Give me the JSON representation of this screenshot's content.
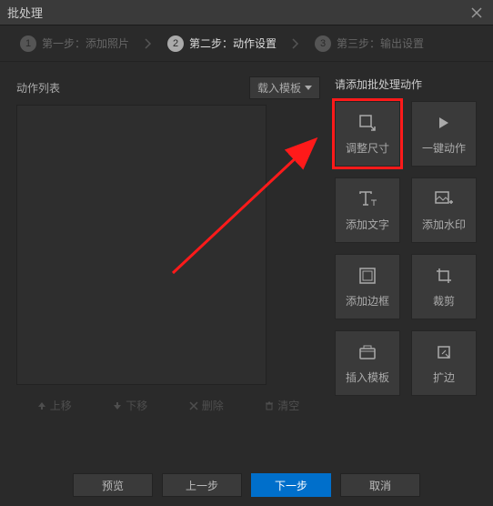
{
  "title": "批处理",
  "steps": {
    "step1": "第一步：添加照片",
    "step2": "第二步：动作设置",
    "step3": "第三步：输出设置"
  },
  "left": {
    "list_label": "动作列表",
    "load_template": "载入模板",
    "move_up": "上移",
    "move_down": "下移",
    "delete": "删除",
    "clear": "清空"
  },
  "right": {
    "title": "请添加批处理动作",
    "actions": {
      "resize": "调整尺寸",
      "onekey": "一键动作",
      "text": "添加文字",
      "watermark": "添加水印",
      "border": "添加边框",
      "crop": "裁剪",
      "template": "插入模板",
      "expand": "扩边"
    }
  },
  "footer": {
    "preview": "预览",
    "prev": "上一步",
    "next": "下一步",
    "cancel": "取消"
  }
}
